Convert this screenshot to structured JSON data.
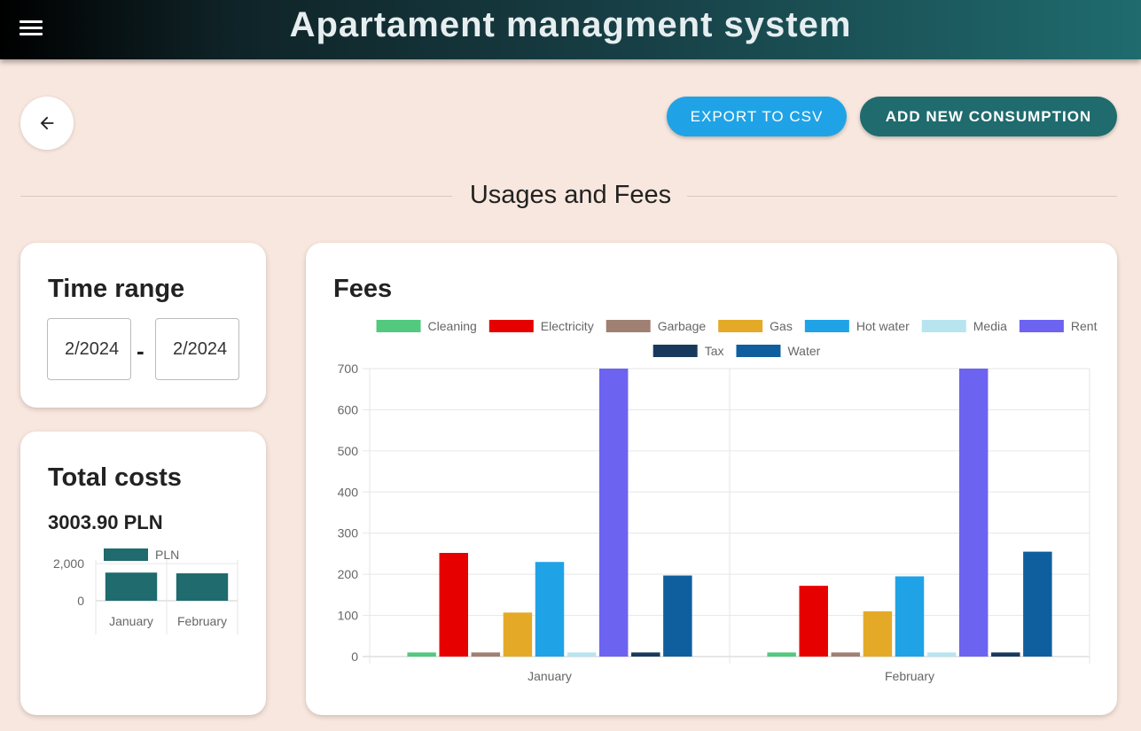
{
  "app": {
    "title": "Apartament managment system"
  },
  "toolbar": {
    "export_label": "EXPORT TO CSV",
    "add_label": "ADD NEW CONSUMPTION"
  },
  "section": {
    "title": "Usages and Fees"
  },
  "time_range": {
    "title": "Time range",
    "from_value": "2/2024",
    "to_value": "2/2024",
    "separator": "-"
  },
  "total": {
    "title": "Total costs",
    "value": "3003.90 PLN"
  },
  "fees": {
    "title": "Fees"
  },
  "colors": {
    "accent": "#1f6b6e",
    "export": "#1fa3e6",
    "background": "#f8e7de"
  },
  "icons": {
    "menu": "menu-icon",
    "back": "arrow-left-icon"
  },
  "chart_data": [
    {
      "type": "bar",
      "categories": [
        "January",
        "February"
      ],
      "series": [
        {
          "name": "PLN",
          "values": [
            1520,
            1480
          ],
          "color": "#1f6b6e"
        }
      ],
      "yticks": [
        "2,000",
        "0"
      ],
      "ylim": [
        0,
        2200
      ],
      "legend": "top",
      "grid": true
    },
    {
      "type": "bar",
      "title": "Fees",
      "categories": [
        "January",
        "February"
      ],
      "series": [
        {
          "name": "Cleaning",
          "values": [
            10,
            10
          ],
          "color": "#52c97e"
        },
        {
          "name": "Electricity",
          "values": [
            252,
            172
          ],
          "color": "#e60000"
        },
        {
          "name": "Garbage",
          "values": [
            10,
            10
          ],
          "color": "#9f8073"
        },
        {
          "name": "Gas",
          "values": [
            107,
            110
          ],
          "color": "#e4aa27"
        },
        {
          "name": "Hot water",
          "values": [
            230,
            195
          ],
          "color": "#1fa3e6"
        },
        {
          "name": "Media",
          "values": [
            10,
            10
          ],
          "color": "#b8e4f0"
        },
        {
          "name": "Rent",
          "values": [
            700,
            700
          ],
          "color": "#6c63f0"
        },
        {
          "name": "Tax",
          "values": [
            10,
            10
          ],
          "color": "#173a5c"
        },
        {
          "name": "Water",
          "values": [
            197,
            255
          ],
          "color": "#0f5f9e"
        }
      ],
      "yticks": [
        "700",
        "600",
        "500",
        "400",
        "300",
        "200",
        "100",
        "0"
      ],
      "ylim": [
        0,
        700
      ],
      "legend": "top",
      "grid": true
    }
  ]
}
